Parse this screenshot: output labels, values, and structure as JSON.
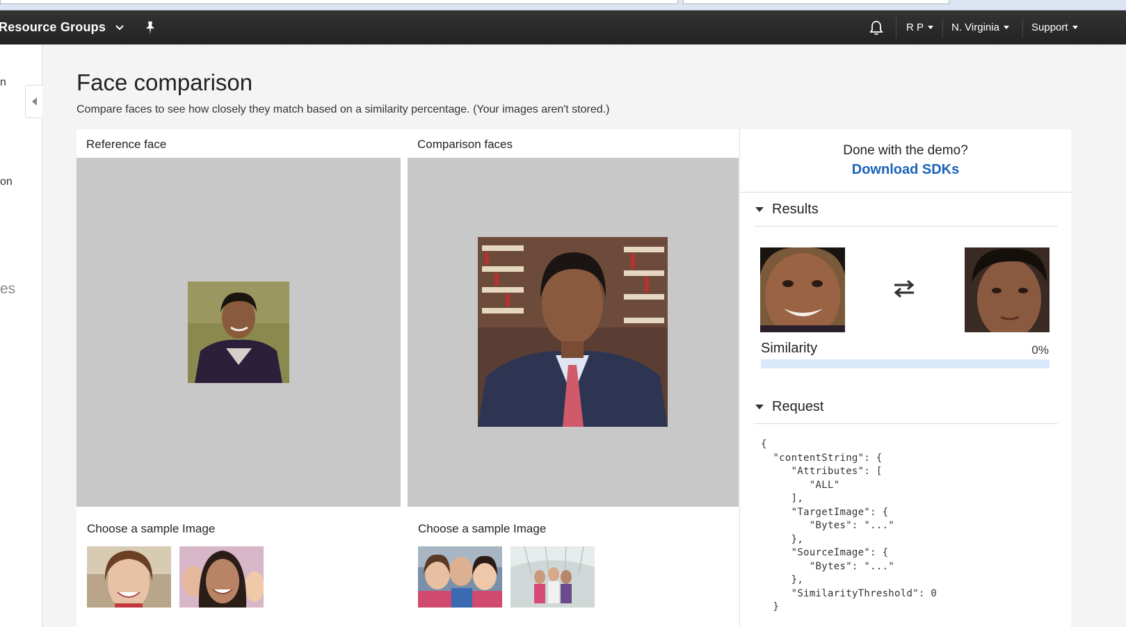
{
  "topnav": {
    "resource_groups": "Resource Groups",
    "user": "R P",
    "region": "N. Virginia",
    "support": "Support"
  },
  "sidebar": {
    "fragments": [
      "n",
      "on",
      "es"
    ]
  },
  "page": {
    "title": "Face comparison",
    "subtitle": "Compare faces to see how closely they match based on a similarity percentage. (Your images aren't stored.)"
  },
  "reference": {
    "label": "Reference face",
    "sample_label": "Choose a sample Image"
  },
  "comparison": {
    "label": "Comparison faces",
    "sample_label": "Choose a sample Image"
  },
  "right": {
    "done_question": "Done with the demo?",
    "download_link": "Download SDKs",
    "results_heading": "Results",
    "similarity_label": "Similarity",
    "similarity_value": "0%",
    "similarity_fraction": 0,
    "request_heading": "Request",
    "request_json": "{\n  \"contentString\": {\n     \"Attributes\": [\n        \"ALL\"\n     ],\n     \"TargetImage\": {\n        \"Bytes\": \"...\"\n     },\n     \"SourceImage\": {\n        \"Bytes\": \"...\"\n     },\n     \"SimilarityThreshold\": 0\n  }"
  },
  "colors": {
    "nav_bg": "#232323",
    "link": "#1a62b8",
    "image_area": "#c8c8c8",
    "similarity_track": "#d7e9fb"
  },
  "icons": [
    "chevron-down-icon",
    "pin-icon",
    "bell-icon",
    "collapse-left-icon",
    "swap-arrows-icon",
    "caret-down-icon"
  ]
}
